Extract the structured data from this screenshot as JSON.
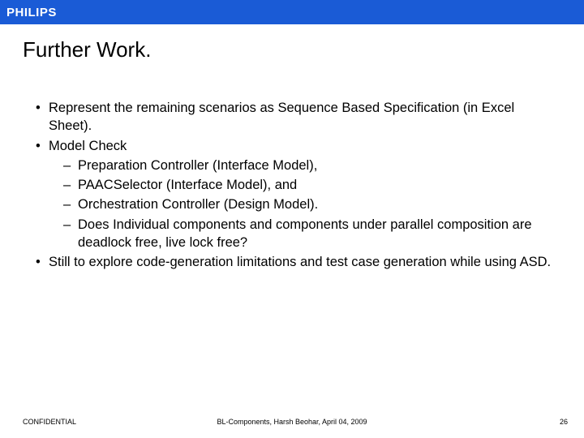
{
  "brand": "PHILIPS",
  "title": "Further Work.",
  "bullets": {
    "b1": "Represent the remaining scenarios as Sequence Based Specification (in Excel Sheet).",
    "b2": "Model Check",
    "b2_subs": {
      "s1": "Preparation Controller (Interface Model),",
      "s2": "PAACSelector (Interface Model), and",
      "s3": "Orchestration Controller (Design Model).",
      "s4": "Does Individual components and components under parallel composition are deadlock free, live lock free?"
    },
    "b3": "Still to explore code-generation limitations and test case generation while using ASD."
  },
  "footer": {
    "left": "CONFIDENTIAL",
    "center": "BL-Components, Harsh Beohar, April 04, 2009",
    "right": "26"
  }
}
